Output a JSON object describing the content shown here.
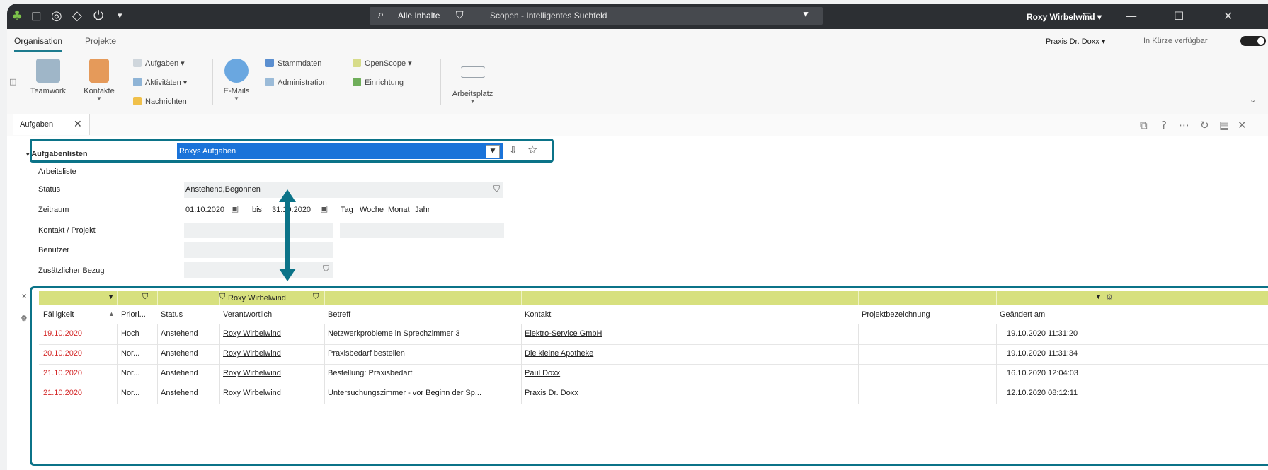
{
  "titlebar": {
    "search_scope": "Alle Inhalte",
    "search_placeholder": "Scopen - Intelligentes Suchfeld",
    "user": "Roxy Wirbelwind"
  },
  "tabs": [
    "Organisation",
    "Projekte"
  ],
  "praxis": "Praxis Dr. Doxx",
  "availability": "In Kürze verfügbar",
  "ribbon": {
    "teamwork": "Teamwork",
    "kontakte": "Kontakte",
    "aufgaben": "Aufgaben",
    "aktivitaeten": "Aktivitäten",
    "nachrichten": "Nachrichten",
    "emails": "E-Mails",
    "stammdaten": "Stammdaten",
    "administration": "Administration",
    "openscope": "OpenScope",
    "einrichtung": "Einrichtung",
    "arbeitsplatz": "Arbeitsplatz"
  },
  "doc_tab": "Aufgaben",
  "form": {
    "section": "Aufgabenlisten",
    "arbeitsliste_label": "Arbeitsliste",
    "arbeitsliste_value": "Roxys Aufgaben",
    "status_label": "Status",
    "status_value": "Anstehend,Begonnen",
    "zeitraum_label": "Zeitraum",
    "date_from": "01.10.2020",
    "bis": "bis",
    "date_to": "31.10.2020",
    "tag": "Tag",
    "woche": "Woche",
    "monat": "Monat",
    "jahr": "Jahr",
    "kontakt_label": "Kontakt / Projekt",
    "benutzer_label": "Benutzer",
    "bezug_label": "Zusätzlicher Bezug"
  },
  "filter": {
    "verantwortlich": "Roxy Wirbelwind"
  },
  "columns": [
    "Fälligkeit",
    "Priori...",
    "Status",
    "Verantwortlich",
    "Betreff",
    "Kontakt",
    "Projektbezeichnung",
    "Geändert am"
  ],
  "rows": [
    {
      "due": "19.10.2020",
      "prio": "Hoch",
      "status": "Anstehend",
      "owner": "Roxy Wirbelwind",
      "subject": "Netzwerkprobleme in Sprechzimmer 3",
      "contact": "Elektro-Service GmbH",
      "project": "",
      "changed": "19.10.2020 11:31:20"
    },
    {
      "due": "20.10.2020",
      "prio": "Nor...",
      "status": "Anstehend",
      "owner": "Roxy Wirbelwind",
      "subject": "Praxisbedarf bestellen",
      "contact": "Die kleine Apotheke",
      "project": "",
      "changed": "19.10.2020 11:31:34"
    },
    {
      "due": "21.10.2020",
      "prio": "Nor...",
      "status": "Anstehend",
      "owner": "Roxy Wirbelwind",
      "subject": "Bestellung: Praxisbedarf",
      "contact": "Paul Doxx",
      "project": "",
      "changed": "16.10.2020 12:04:03"
    },
    {
      "due": "21.10.2020",
      "prio": "Nor...",
      "status": "Anstehend",
      "owner": "Roxy Wirbelwind",
      "subject": "Untersuchungszimmer - vor Beginn der Sp...",
      "contact": "Praxis Dr. Doxx",
      "project": "",
      "changed": "12.10.2020 08:12:11"
    }
  ],
  "colors": {
    "accent": "#0b7388",
    "filterbar": "#d7e07e",
    "selection": "#1a73d9",
    "due_red": "#d42a2a"
  }
}
